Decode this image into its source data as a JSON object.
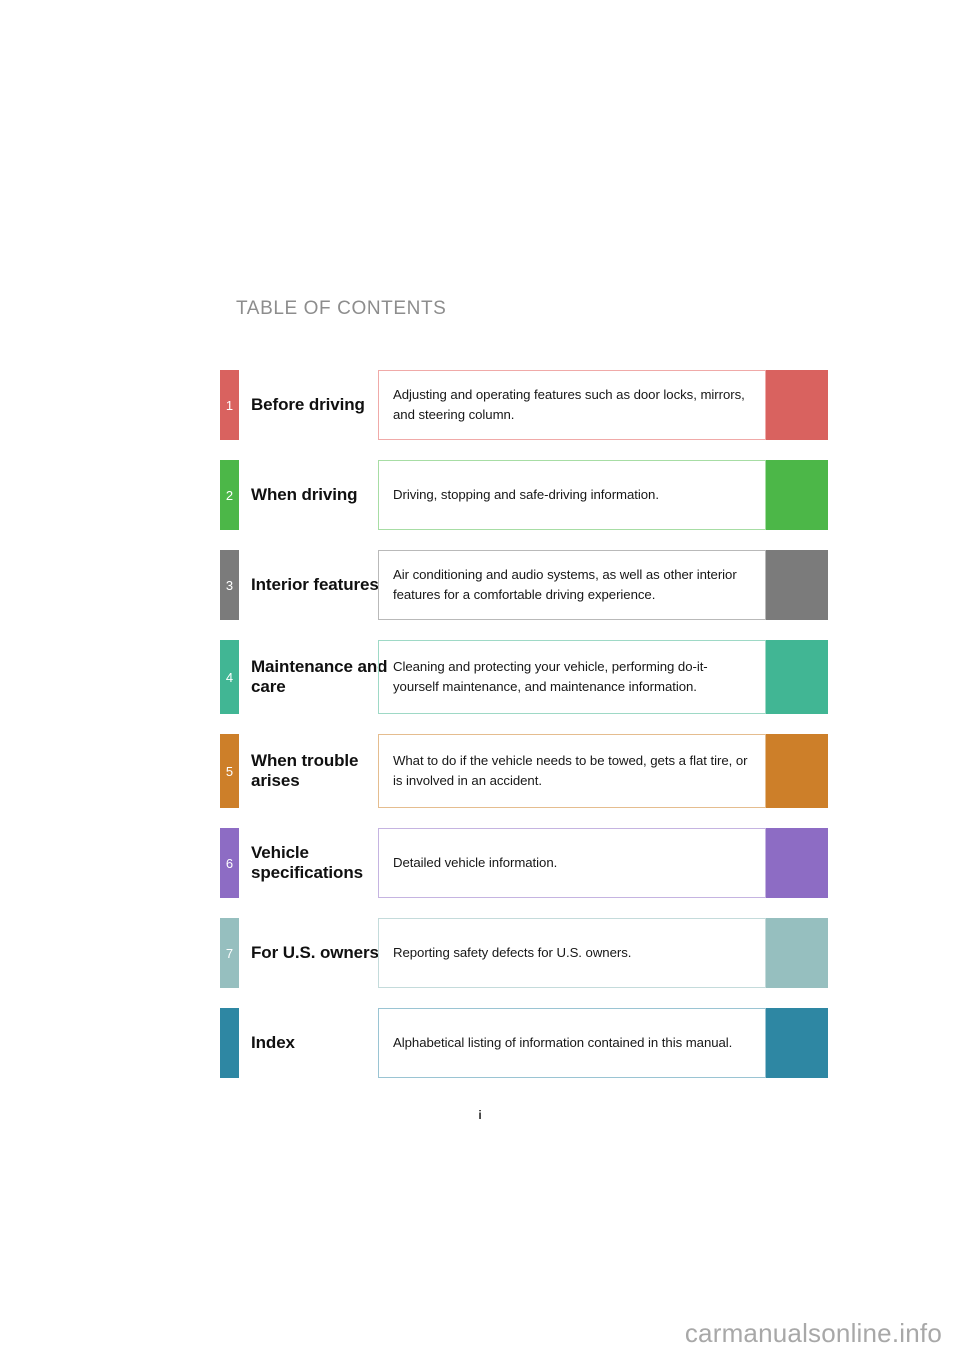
{
  "page": {
    "title": "TABLE OF CONTENTS",
    "page_number": "i",
    "watermark": "carmanualsonline.info"
  },
  "sections": [
    {
      "number": "1",
      "title": "Before driving",
      "description": "Adjusting and operating features such as door locks, mirrors, and steering column.",
      "color": "#d9625f",
      "border_color": "#f0aaa8"
    },
    {
      "number": "2",
      "title": "When driving",
      "description": "Driving, stopping and safe-driving information.",
      "color": "#4cb748",
      "border_color": "#a7dda4"
    },
    {
      "number": "3",
      "title": "Interior features",
      "description": "Air conditioning and audio systems, as well as other interior features for a comfortable driving experience.",
      "color": "#7b7b7b",
      "border_color": "#b9b9b9"
    },
    {
      "number": "4",
      "title": "Maintenance and care",
      "description": "Cleaning and protecting your vehicle, performing do-it-yourself maintenance, and maintenance information.",
      "color": "#41b694",
      "border_color": "#9ed9c6"
    },
    {
      "number": "5",
      "title": "When trouble arises",
      "description": "What to do if the vehicle needs to be towed, gets a flat tire, or is involved in an accident.",
      "color": "#cd7f29",
      "border_color": "#e5bd8f"
    },
    {
      "number": "6",
      "title": "Vehicle specifications",
      "description": "Detailed vehicle information.",
      "color": "#8d6cc4",
      "border_color": "#c5b4e1"
    },
    {
      "number": "7",
      "title": "For U.S. owners",
      "description": "Reporting safety defects for U.S. owners.",
      "color": "#96bfbf",
      "border_color": "#c4dbdb"
    },
    {
      "number": "",
      "title": "Index",
      "description": "Alphabetical listing of information contained in this manual.",
      "color": "#2e87a3",
      "border_color": "#9ac4d3"
    }
  ]
}
